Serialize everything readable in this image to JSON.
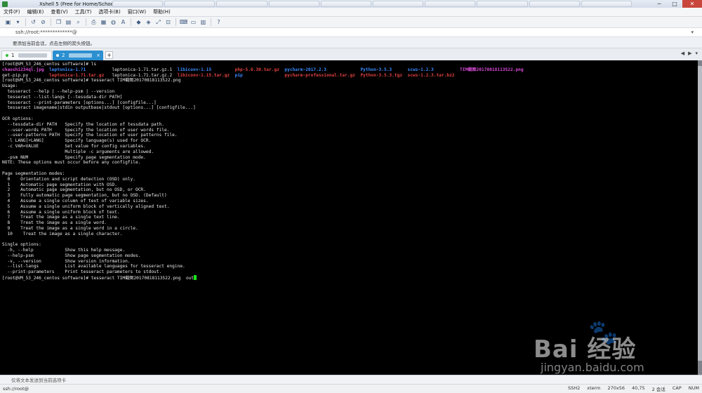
{
  "window": {
    "title": "Xshell 5 (Free for Home/School)"
  },
  "window_controls": {
    "minimize": "─",
    "maximize": "□",
    "close": "✕"
  },
  "menu": [
    "文件(F)",
    "编辑(E)",
    "查看(V)",
    "工具(T)",
    "选项卡(B)",
    "窗口(W)",
    "帮助(H)"
  ],
  "toolbar_icons": [
    "new-session-icon",
    "open-icon",
    "reconnect-icon",
    "disconnect-icon",
    "copy-icon",
    "paste-icon",
    "find-icon",
    "print-icon",
    "properties-icon",
    "globe-icon",
    "font-icon",
    "xftp-icon",
    "xmanager-icon",
    "fullscreen-icon",
    "lock-icon",
    "keyboard-icon",
    "compose-icon",
    "layout-icon",
    "help-icon"
  ],
  "address": {
    "value": "ssh://root:*************@",
    "dropdown": "▾"
  },
  "hint": {
    "text": "要添加当前会话，点击左侧的箭头按钮。"
  },
  "tabs": [
    {
      "number": "1",
      "dot_color": "#2fbf3a",
      "active": false
    },
    {
      "number": "2",
      "dot_color": "#ffffff",
      "active": true
    }
  ],
  "tab_new": "+",
  "tab_nav": {
    "prev": "◀",
    "next": "▶",
    "menu": "▾"
  },
  "terminal": {
    "prompt_ls": "[root@VM_53_246_centos software]# ls",
    "ls_rows": [
      [
        {
          "t": "chaoshi234ql.jpg",
          "c": "mg"
        },
        {
          "t": "leptonica-1.71",
          "c": "bl"
        },
        {
          "t": "leptonica-1.71.tar.gz.1",
          "c": ""
        },
        {
          "t": "libiconv-1.15",
          "c": "bl"
        },
        {
          "t": "php-5.6.30.tar.gz",
          "c": "rd"
        },
        {
          "t": "pycharm-2017.2.3",
          "c": "bl"
        },
        {
          "t": "Python-3.5.3",
          "c": "bl"
        },
        {
          "t": "scws-1.2.3",
          "c": "bl"
        },
        {
          "t": "TIM截图20170818113522.png",
          "c": "mg"
        }
      ],
      [
        {
          "t": "get-pip.py",
          "c": ""
        },
        {
          "t": "leptonica-1.71.tar.gz",
          "c": "rd"
        },
        {
          "t": "leptonica-1.71.tar.gz.2",
          "c": ""
        },
        {
          "t": "libiconv-1.15.tar.gz",
          "c": "rd"
        },
        {
          "t": "pip",
          "c": "bl"
        },
        {
          "t": "pycharm-professional.tar.gz",
          "c": "rd"
        },
        {
          "t": "Python-3.5.3.tgz",
          "c": "rd"
        },
        {
          "t": "scws-1.2.3.tar.bz2",
          "c": "rd"
        }
      ]
    ],
    "output": "[root@VM_53_246_centos software]# tesseract TIM截图20170818113522.png\nUsage:\n  tesseract --help | --help-psm | --version\n  tesseract --list-langs [--tessdata-dir PATH]\n  tesseract --print-parameters [options...] [configfile...]\n  tesseract imagename|stdin outputbase|stdout [options...] [configfile...]\n\nOCR options:\n  --tessdata-dir PATH   Specify the location of tessdata path.\n  --user-words PATH     Specify the location of user words file.\n  --user-patterns PATH  Specify the location of user patterns file.\n  -l LANG[+LANG]        Specify language(s) used for OCR.\n  -c VAR=VALUE          Set value for config variables.\n                        Multiple -c arguments are allowed.\n  -psm NUM              Specify page segmentation mode.\nNOTE: These options must occur before any configfile.\n\nPage segmentation modes:\n  0    Orientation and script detection (OSD) only.\n  1    Automatic page segmentation with OSD.\n  2    Automatic page segmentation, but no OSD, or OCR.\n  3    Fully automatic page segmentation, but no OSD. (Default)\n  4    Assume a single column of text of variable sizes.\n  5    Assume a single uniform block of vertically aligned text.\n  6    Assume a single uniform block of text.\n  7    Treat the image as a single text line.\n  8    Treat the image as a single word.\n  9    Treat the image as a single word in a circle.\n  10    Treat the image as a single character.\n\nSingle options:\n  -h, --help            Show this help message.\n  --help-psm            Show page segmentation modes.\n  -v, --version         Show version information.\n  --list-langs          List available languages for tesseract engine.\n  --print-parameters    Print tesseract parameters to stdout.\n",
    "last_prompt": "[root@VM_53_246_centos software]# tesseract TIM截图20170818113522.png  out"
  },
  "send_bar": {
    "placeholder": "仅将文本发送到当前选项卡"
  },
  "status": {
    "left": "ssh://root@",
    "protocol": "SSH2",
    "term": "xterm",
    "size": "270x56",
    "cursor": "40,75",
    "sessions": "2 会话",
    "caps": "CAP",
    "num": "NUM"
  },
  "watermark": {
    "brand": "Bai 经验",
    "url": "jingyan.baidu.com"
  }
}
